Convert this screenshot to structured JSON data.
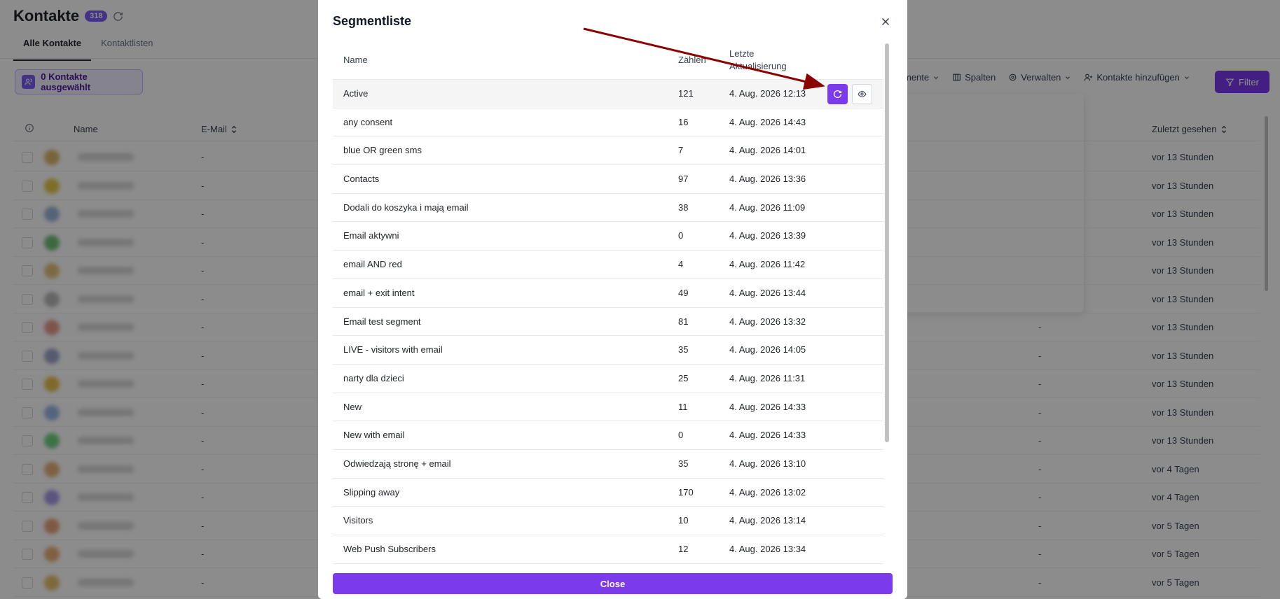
{
  "background": {
    "title": "Kontakte",
    "count": "318",
    "tabs": [
      "Alle Kontakte",
      "Kontaktlisten"
    ],
    "selected_label": "0 Kontakte ausgewählt",
    "toolbar": {
      "segments": "mente",
      "columns": "Spalten",
      "manage": "Verwalten",
      "add_contacts": "Kontakte hinzufügen",
      "filter": "Filter"
    },
    "table_headers": {
      "name": "Name",
      "email": "E-Mail",
      "last_seen": "Zuletzt gesehen"
    },
    "rows": [
      {
        "email": "-",
        "mid": "",
        "seen": "vor 13 Stunden",
        "avatar": "#d9b86a"
      },
      {
        "email": "-",
        "mid": "",
        "seen": "vor 13 Stunden",
        "avatar": "#e6c84a"
      },
      {
        "email": "-",
        "mid": "",
        "seen": "vor 13 Stunden",
        "avatar": "#9ab6d8"
      },
      {
        "email": "-",
        "mid": "",
        "seen": "vor 13 Stunden",
        "avatar": "#6fbf73"
      },
      {
        "email": "-",
        "mid": "",
        "seen": "vor 13 Stunden",
        "avatar": "#e3c27a"
      },
      {
        "email": "-",
        "mid": "",
        "seen": "vor 13 Stunden",
        "avatar": "#b9b9b9"
      },
      {
        "email": "-",
        "mid": "-",
        "seen": "vor 13 Stunden",
        "avatar": "#e79a8a"
      },
      {
        "email": "-",
        "mid": "-",
        "seen": "vor 13 Stunden",
        "avatar": "#9aa7c9"
      },
      {
        "email": "-",
        "mid": "-",
        "seen": "vor 13 Stunden",
        "avatar": "#e8c04a"
      },
      {
        "email": "-",
        "mid": "-",
        "seen": "vor 13 Stunden",
        "avatar": "#9ab6e8"
      },
      {
        "email": "-",
        "mid": "-",
        "seen": "vor 13 Stunden",
        "avatar": "#6fcf7f"
      },
      {
        "email": "-",
        "mid": "-",
        "seen": "vor 4 Tagen",
        "avatar": "#e6b07a"
      },
      {
        "email": "-",
        "mid": "-",
        "seen": "vor 4 Tagen",
        "avatar": "#a49ae8"
      },
      {
        "email": "-",
        "mid": "-",
        "seen": "vor 5 Tagen",
        "avatar": "#e8a17a"
      },
      {
        "email": "-",
        "mid": "-",
        "seen": "vor 5 Tagen",
        "avatar": "#e8b07a"
      },
      {
        "email": "-",
        "mid": "-",
        "seen": "vor 5 Tagen",
        "avatar": "#e6c06a"
      }
    ]
  },
  "modal": {
    "title": "Segmentliste",
    "headers": {
      "name": "Name",
      "count": "Zählen",
      "updated": "Letzte Aktualisierung"
    },
    "rows": [
      {
        "name": "Active",
        "count": "121",
        "date": "4. Aug. 2026 12:13"
      },
      {
        "name": "any consent",
        "count": "16",
        "date": "4. Aug. 2026 14:43"
      },
      {
        "name": "blue OR green sms",
        "count": "7",
        "date": "4. Aug. 2026 14:01"
      },
      {
        "name": "Contacts",
        "count": "97",
        "date": "4. Aug. 2026 13:36"
      },
      {
        "name": "Dodali do koszyka i mają email",
        "count": "38",
        "date": "4. Aug. 2026 11:09"
      },
      {
        "name": "Email aktywni",
        "count": "0",
        "date": "4. Aug. 2026 13:39"
      },
      {
        "name": "email AND red",
        "count": "4",
        "date": "4. Aug. 2026 11:42"
      },
      {
        "name": "email + exit intent",
        "count": "49",
        "date": "4. Aug. 2026 13:44"
      },
      {
        "name": "Email test segment",
        "count": "81",
        "date": "4. Aug. 2026 13:32"
      },
      {
        "name": "LIVE - visitors with email",
        "count": "35",
        "date": "4. Aug. 2026 14:05"
      },
      {
        "name": "narty dla dzieci",
        "count": "25",
        "date": "4. Aug. 2026 11:31"
      },
      {
        "name": "New",
        "count": "11",
        "date": "4. Aug. 2026 14:33"
      },
      {
        "name": "New with email",
        "count": "0",
        "date": "4. Aug. 2026 14:33"
      },
      {
        "name": "Odwiedzają stronę + email",
        "count": "35",
        "date": "4. Aug. 2026 13:10"
      },
      {
        "name": "Slipping away",
        "count": "170",
        "date": "4. Aug. 2026 13:02"
      },
      {
        "name": "Visitors",
        "count": "10",
        "date": "4. Aug. 2026 13:14"
      },
      {
        "name": "Web Push Subscribers",
        "count": "12",
        "date": "4. Aug. 2026 13:34"
      }
    ],
    "close_label": "Close"
  },
  "colors": {
    "accent": "#7c3aed",
    "annotation_arrow": "#8b0000"
  },
  "icons": {
    "row_refresh": "refresh-icon",
    "row_view": "eye-icon",
    "modal_close": "close-icon"
  }
}
